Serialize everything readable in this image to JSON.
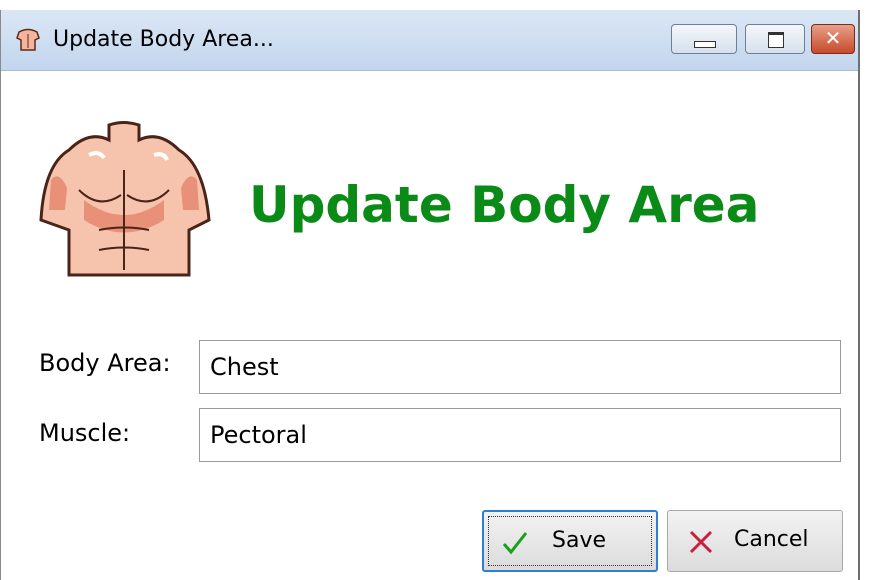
{
  "window": {
    "title": "Update Body Area...",
    "controls": {
      "minimize": "minimize",
      "maximize": "maximize",
      "close": "close"
    }
  },
  "header": {
    "heading": "Update Body Area",
    "icon": "torso-icon"
  },
  "form": {
    "body_area_label": "Body Area:",
    "body_area_value": "Chest",
    "muscle_label": "Muscle:",
    "muscle_value": "Pectoral"
  },
  "buttons": {
    "save_label": "Save",
    "cancel_label": "Cancel"
  },
  "colors": {
    "heading": "#0a8a16",
    "save_check": "#18a018",
    "cancel_x": "#c8203a",
    "focus_border": "#2d7fd0"
  }
}
